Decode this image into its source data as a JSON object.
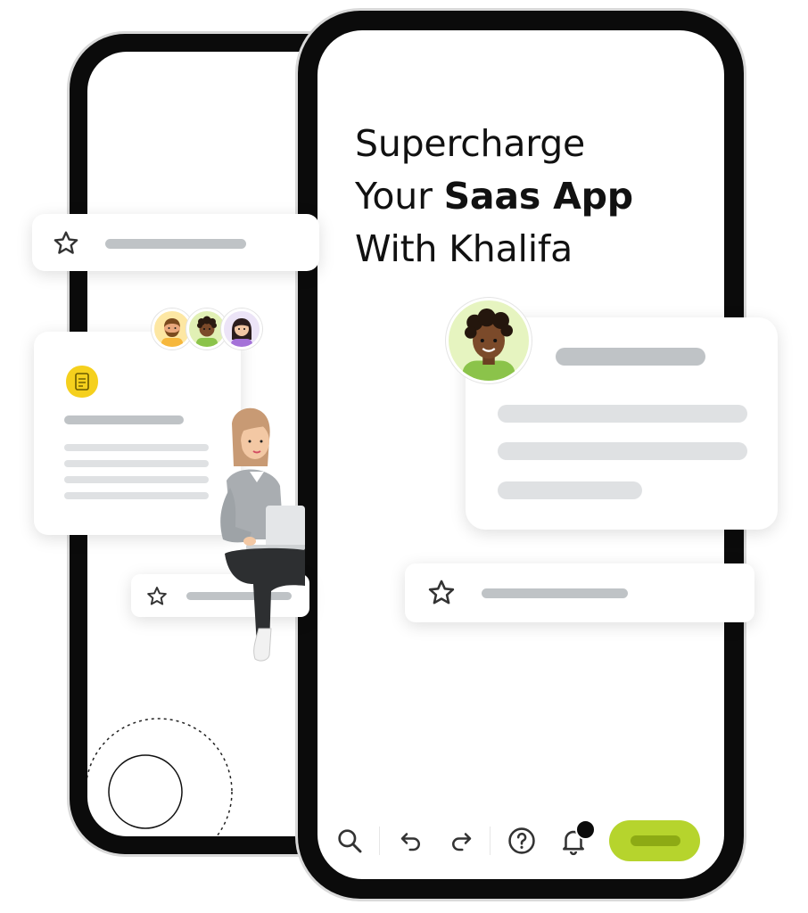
{
  "headline": {
    "line1": "Supercharge",
    "line2_regular": "Your ",
    "line2_bold": "Saas App",
    "line3": "With Khalifa"
  },
  "colors": {
    "accent": "#b6d42d",
    "accent_dark": "#8daa14",
    "doc_badge": "#f5d01d",
    "phone_frame": "#0b0b0b",
    "placeholder_dark": "#bfc3c6",
    "placeholder_light": "#dfe1e3"
  },
  "icons": {
    "star": "star-icon",
    "document": "document-icon",
    "search": "search-icon",
    "undo": "undo-icon",
    "redo": "redo-icon",
    "help": "help-icon",
    "bell": "bell-icon"
  }
}
